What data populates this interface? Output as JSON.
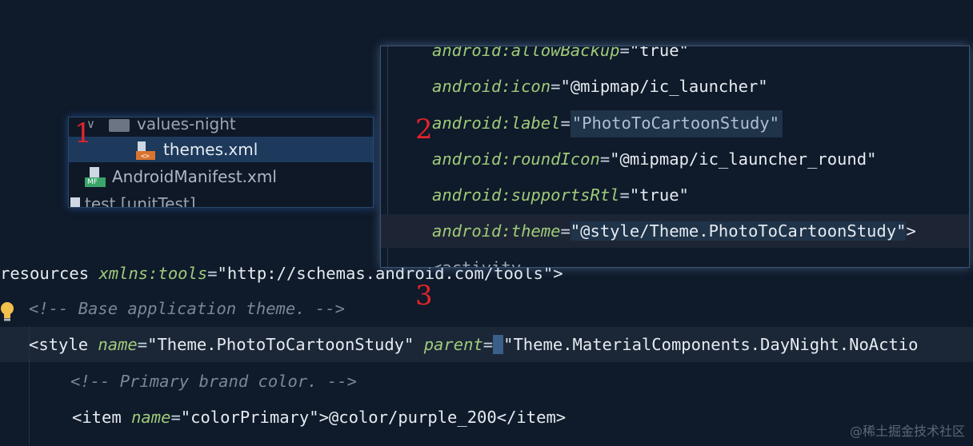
{
  "project_tree": {
    "items": [
      {
        "label": "values-night",
        "icon": "folder-icon"
      },
      {
        "label": "themes.xml",
        "icon": "xml-file-icon"
      },
      {
        "label": "AndroidManifest.xml",
        "icon": "manifest-file-icon",
        "icon_badge": "MF"
      },
      {
        "label": "test [unitTest]",
        "icon": "folder-icon"
      }
    ]
  },
  "manifest_editor": {
    "lines": [
      {
        "attr": "android:allowBackup",
        "value": "\"true\""
      },
      {
        "attr": "android:icon",
        "value": "\"@mipmap/ic_launcher\""
      },
      {
        "attr": "android:label",
        "value": "\"PhotoToCartoonStudy\""
      },
      {
        "attr": "android:roundIcon",
        "value": "\"@mipmap/ic_launcher_round\""
      },
      {
        "attr": "android:supportsRtl",
        "value": "\"true\""
      },
      {
        "attr": "android:theme",
        "value": "\"@style/Theme.PhotoToCartoonStudy\"",
        "suffix": ">"
      },
      {
        "partial": "<activity"
      }
    ]
  },
  "themes_editor": {
    "line1": {
      "text": "resources",
      "attr": "xmlns:tools",
      "value": "\"http://schemas.android.com/tools\"",
      "suffix": ">"
    },
    "line2": {
      "comment": "<!-- Base application theme. -->"
    },
    "line3": {
      "open": "<style ",
      "attr1": "name",
      "value1": "\"Theme.PhotoToCartoonStudy\"",
      "attr2": "parent",
      "value2": "\"Theme.MaterialComponents.DayNight.NoActio"
    },
    "line4": {
      "comment": "<!-- Primary brand color. -->"
    },
    "line5": {
      "open": "<item ",
      "attr": "name",
      "value": "\"colorPrimary\"",
      "content": ">@color/purple_200</item>"
    }
  },
  "annotations": {
    "label1": "1",
    "label2": "2",
    "label3": "3"
  },
  "watermark": "@稀土掘金技术社区",
  "colors": {
    "background": "#0f1a2a",
    "attribute": "#9fca7a",
    "annotation_red": "#e0242c",
    "selection": "#1d3a5c"
  }
}
